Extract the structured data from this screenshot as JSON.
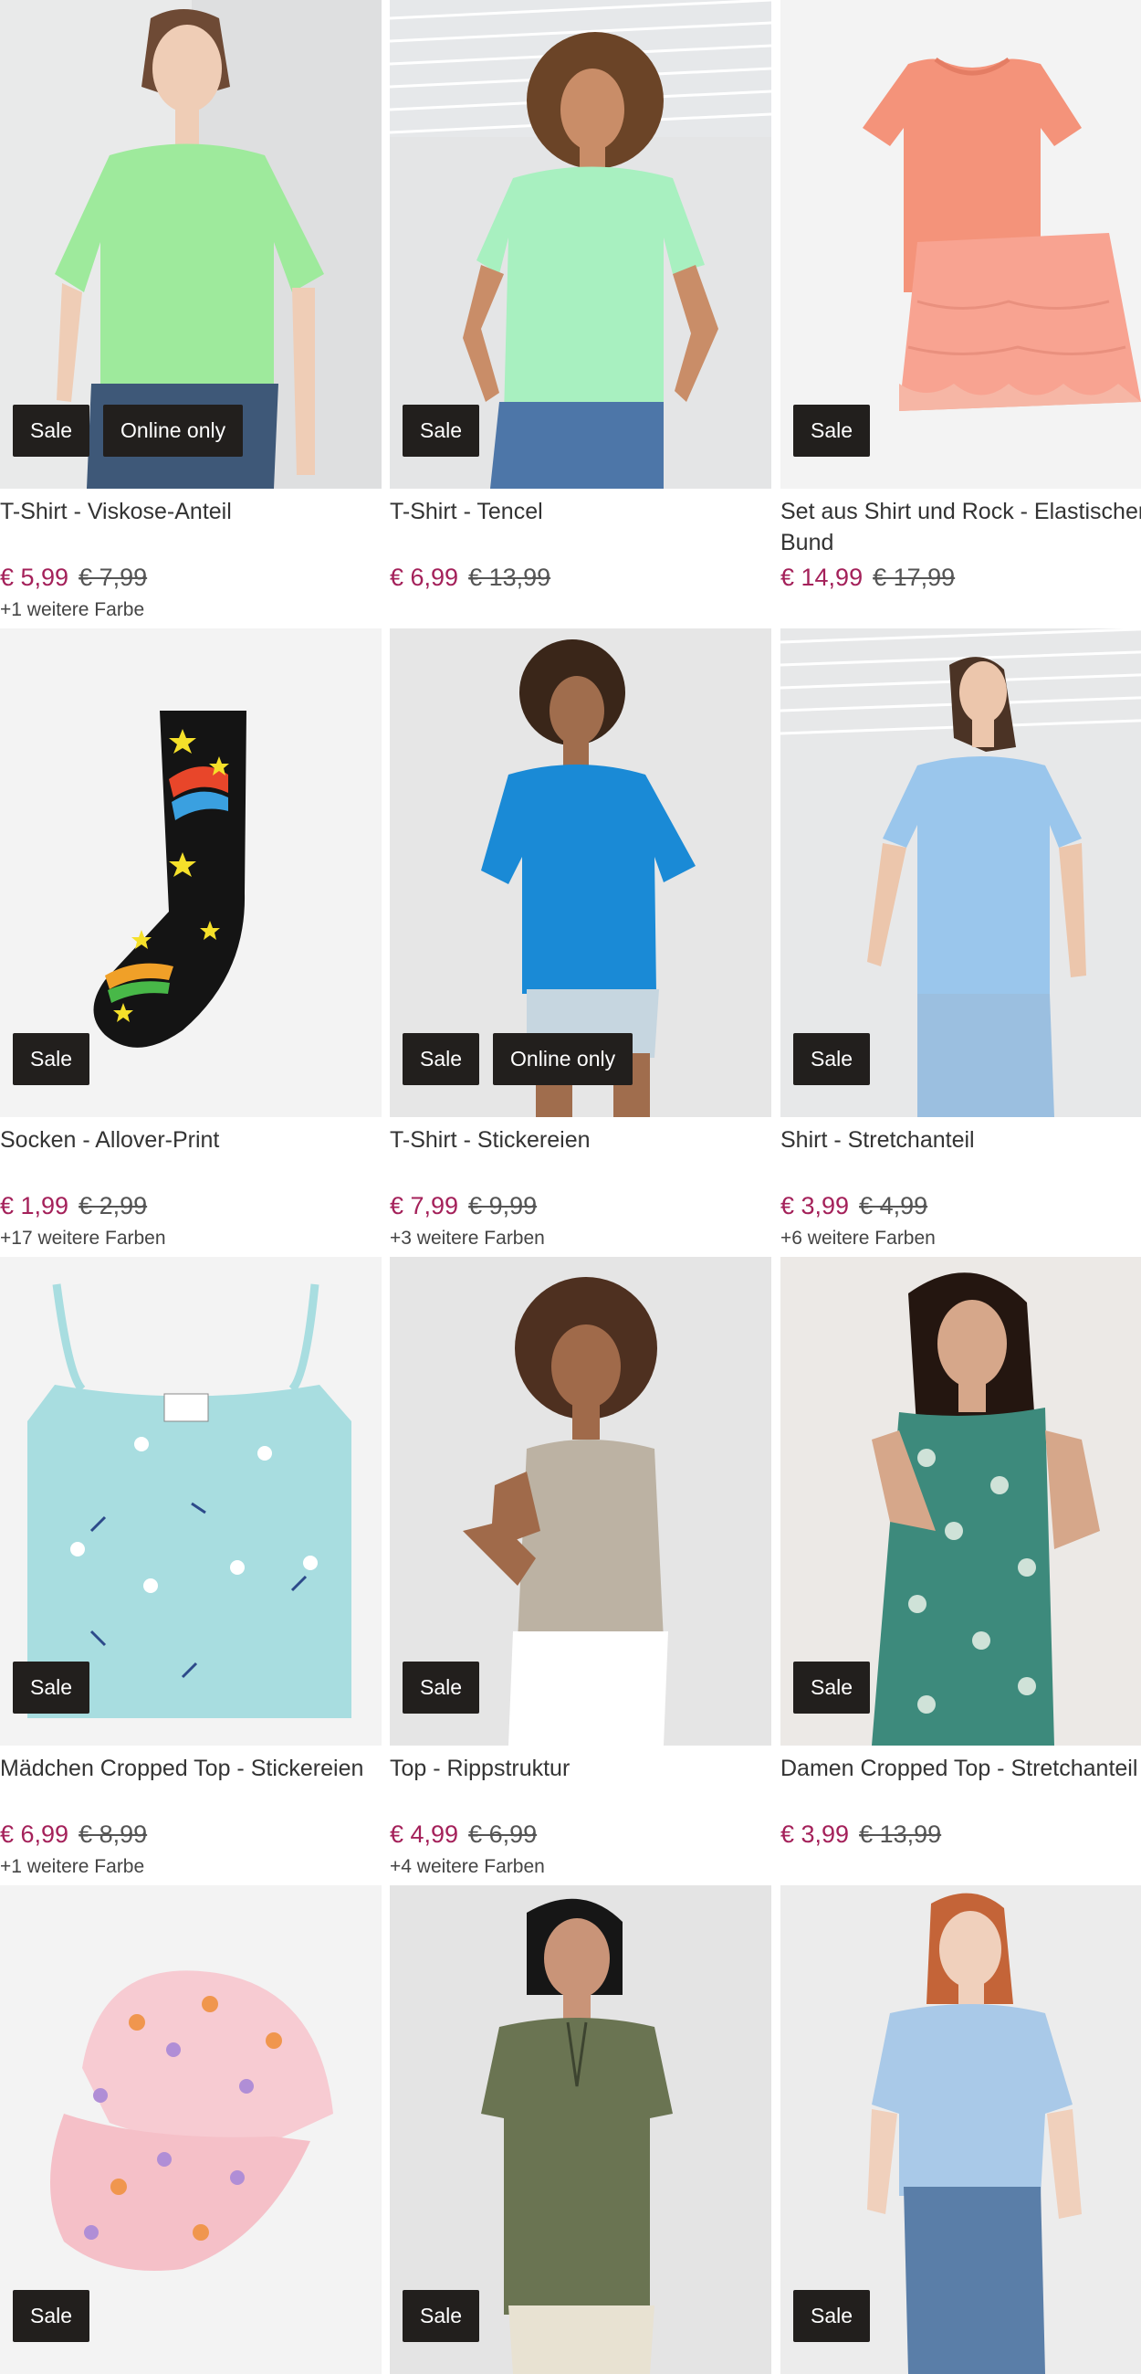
{
  "products": [
    {
      "title": "T-Shirt - Viskose-Anteil",
      "price": "€ 5,99",
      "old_price": "€ 7,99",
      "colors": "+1 weitere Farbe",
      "badges": [
        "Sale",
        "Online only"
      ],
      "image": "woman-green-tshirt-image"
    },
    {
      "title": "T-Shirt - Tencel",
      "price": "€ 6,99",
      "old_price": "€ 13,99",
      "colors": "",
      "badges": [
        "Sale"
      ],
      "image": "woman-mint-tshirt-image"
    },
    {
      "title": "Set aus Shirt und Rock - Elastischer Bund",
      "price": "€ 14,99",
      "old_price": "€ 17,99",
      "colors": "",
      "badges": [
        "Sale"
      ],
      "image": "coral-shirt-skirt-set-image"
    },
    {
      "title": "Socken - Allover-Print",
      "price": "€ 1,99",
      "old_price": "€ 2,99",
      "colors": "+17 weitere Farben",
      "badges": [
        "Sale"
      ],
      "image": "black-star-sock-image"
    },
    {
      "title": "T-Shirt - Stickereien",
      "price": "€ 7,99",
      "old_price": "€ 9,99",
      "colors": "+3 weitere Farben",
      "badges": [
        "Sale",
        "Online only"
      ],
      "image": "woman-blue-tshirt-image"
    },
    {
      "title": "Shirt - Stretchanteil",
      "price": "€ 3,99",
      "old_price": "€ 4,99",
      "colors": "+6 weitere Farben",
      "badges": [
        "Sale"
      ],
      "image": "woman-light-blue-shirt-image"
    },
    {
      "title": "Mädchen Cropped Top - Stickereien",
      "price": "€ 6,99",
      "old_price": "€ 8,99",
      "colors": "+1 weitere Farbe",
      "badges": [
        "Sale"
      ],
      "image": "aqua-cropped-top-image"
    },
    {
      "title": "Top - Rippstruktur",
      "price": "€ 4,99",
      "old_price": "€ 6,99",
      "colors": "+4 weitere Farben",
      "badges": [
        "Sale"
      ],
      "image": "woman-beige-top-image"
    },
    {
      "title": "Damen Cropped Top - Stretchanteil",
      "price": "€ 3,99",
      "old_price": "€ 13,99",
      "colors": "",
      "badges": [
        "Sale"
      ],
      "image": "woman-printed-top-image"
    },
    {
      "title": "",
      "price": "",
      "old_price": "",
      "colors": "",
      "badges": [
        "Sale"
      ],
      "image": "floral-cap-image"
    },
    {
      "title": "",
      "price": "",
      "old_price": "",
      "colors": "",
      "badges": [
        "Sale"
      ],
      "image": "woman-olive-blouse-image"
    },
    {
      "title": "",
      "price": "",
      "old_price": "",
      "colors": "",
      "badges": [
        "Sale"
      ],
      "image": "woman-light-blue-tshirt-image"
    }
  ],
  "colors": {
    "price": "#a4215a",
    "badge_background": "#221f1d",
    "badge_text": "#ffffff",
    "image_background": "#f1f1f1"
  }
}
